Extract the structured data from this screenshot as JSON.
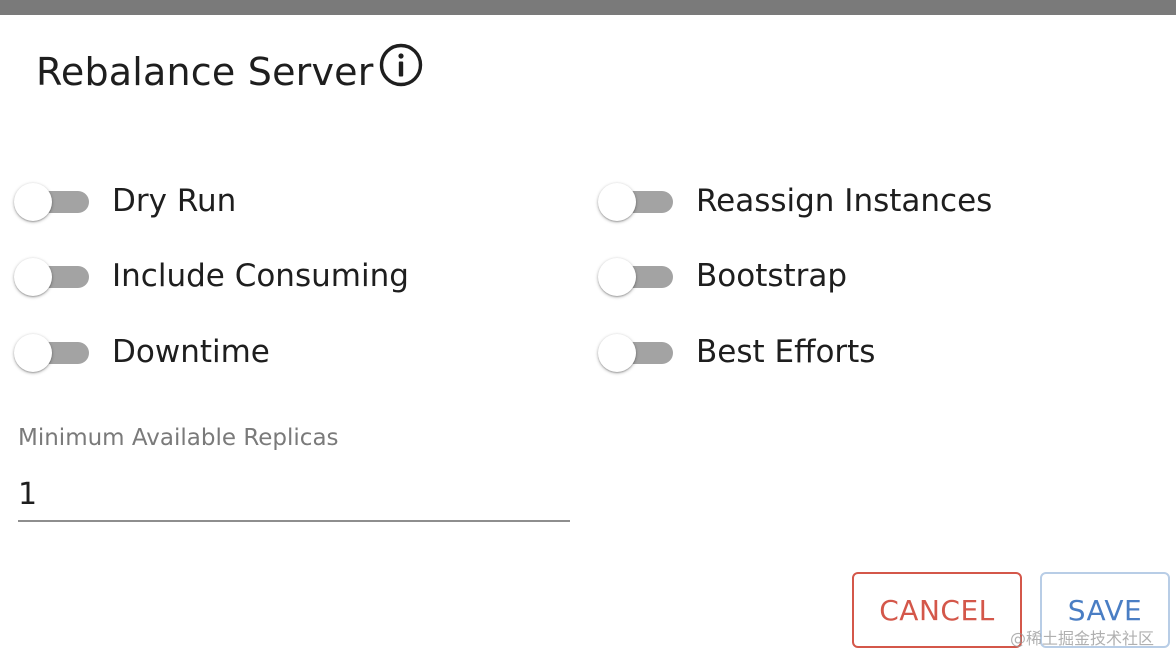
{
  "dialog": {
    "title": "Rebalance Server",
    "info_icon": "info-circle-icon"
  },
  "toggles": {
    "dry_run": {
      "label": "Dry Run",
      "checked": false
    },
    "include_consuming": {
      "label": "Include Consuming",
      "checked": false
    },
    "downtime": {
      "label": "Downtime",
      "checked": false
    },
    "reassign_instances": {
      "label": "Reassign Instances",
      "checked": false
    },
    "bootstrap": {
      "label": "Bootstrap",
      "checked": false
    },
    "best_efforts": {
      "label": "Best Efforts",
      "checked": false
    }
  },
  "min_replicas": {
    "label": "Minimum Available Replicas",
    "value": "1"
  },
  "actions": {
    "cancel_label": "CANCEL",
    "save_label": "SAVE"
  },
  "watermark": "@稀土掘金技术社区",
  "colors": {
    "cancel": "#d4574a",
    "save": "#4a7ec4",
    "switch_track_off": "#a3a3a3",
    "top_bar": "#7a7a7a"
  }
}
